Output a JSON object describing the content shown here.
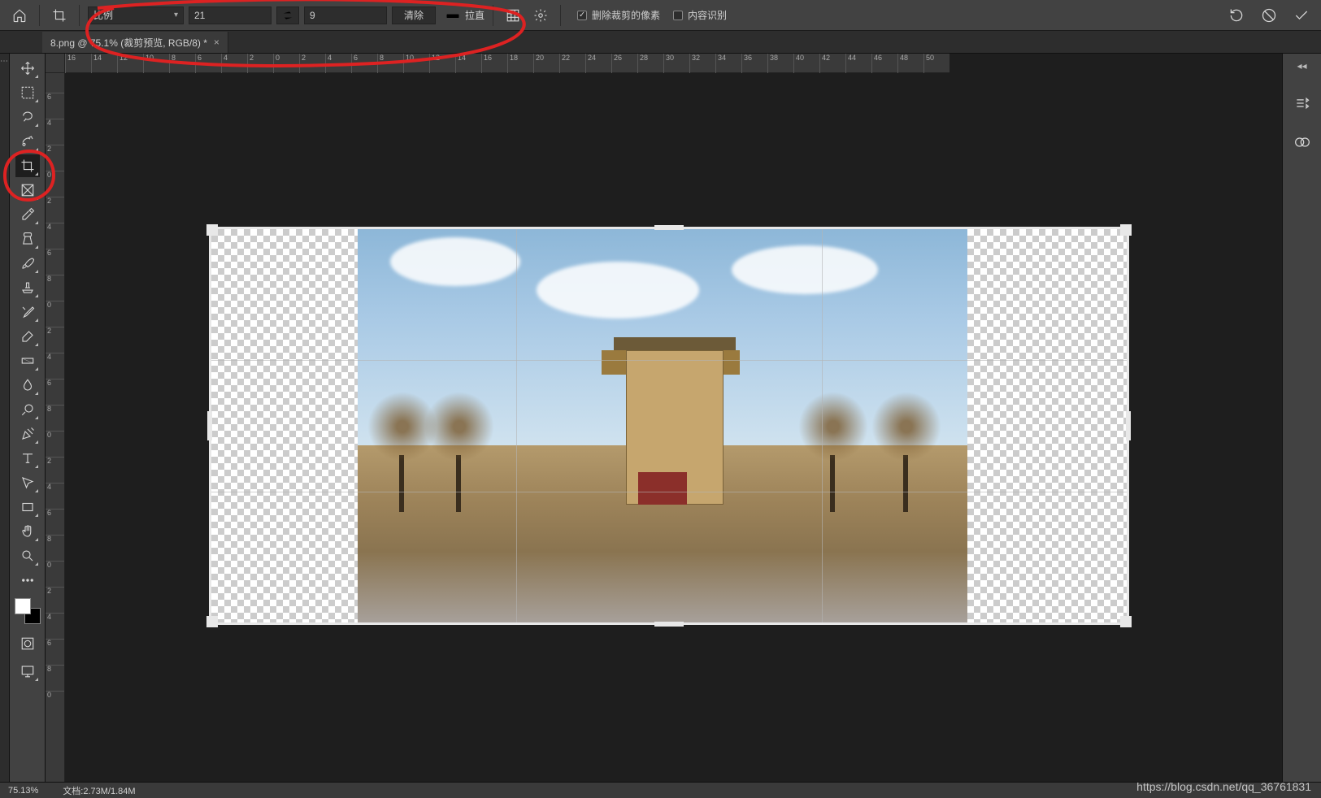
{
  "options": {
    "preset_label": "比例",
    "width_value": "21",
    "height_value": "9",
    "clear_label": "清除",
    "straighten_label": "拉直",
    "delete_cropped_label": "删除裁剪的像素",
    "delete_cropped_checked": true,
    "content_aware_label": "内容识别",
    "content_aware_checked": false
  },
  "tab": {
    "title": "8.png @ 75.1% (裁剪预览, RGB/8) *"
  },
  "ruler_h": [
    "16",
    "14",
    "12",
    "10",
    "8",
    "6",
    "4",
    "2",
    "0",
    "2",
    "4",
    "6",
    "8",
    "10",
    "12",
    "14",
    "16",
    "18",
    "20",
    "22",
    "24",
    "26",
    "28",
    "30",
    "32",
    "34",
    "36",
    "38",
    "40",
    "42",
    "44",
    "46",
    "48",
    "50"
  ],
  "ruler_v": [
    "6",
    "4",
    "2",
    "0",
    "2",
    "4",
    "6",
    "8",
    "0",
    "2",
    "4",
    "6",
    "8",
    "0",
    "2",
    "4",
    "6",
    "8",
    "0",
    "2",
    "4",
    "6",
    "8",
    "0"
  ],
  "status": {
    "zoom": "75.13%",
    "doc_label": "文档:",
    "doc_sizes": "2.73M/1.84M"
  },
  "watermark": "https://blog.csdn.net/qq_36761831"
}
